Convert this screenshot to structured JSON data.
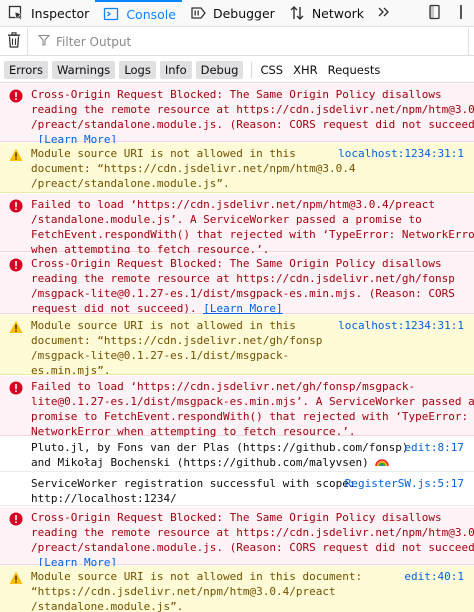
{
  "toolbar": {
    "tabs": [
      {
        "label": "Inspector"
      },
      {
        "label": "Console"
      },
      {
        "label": "Debugger"
      },
      {
        "label": "Network"
      }
    ]
  },
  "filter": {
    "placeholder": "Filter Output"
  },
  "levels": [
    "Errors",
    "Warnings",
    "Logs",
    "Info",
    "Debug"
  ],
  "types": [
    "CSS",
    "XHR",
    "Requests"
  ],
  "learn_more": "[Learn More]",
  "messages": [
    {
      "type": "error",
      "lines": [
        "Cross-Origin Request Blocked: The Same Origin Policy disallows",
        "reading the remote resource at https://cdn.jsdelivr.net/npm/htm@3.0.4",
        "/preact/standalone.module.js. (Reason: CORS request did not succeed)."
      ]
    },
    {
      "type": "warn",
      "lines": [
        "Module source URI is not allowed in this",
        "document: “https://cdn.jsdelivr.net/npm/htm@3.0.4",
        "/preact/standalone.module.js”."
      ],
      "location": "localhost:1234:31:1"
    },
    {
      "type": "error",
      "lines": [
        "Failed to load ‘https://cdn.jsdelivr.net/npm/htm@3.0.4/preact",
        "/standalone.module.js’. A ServiceWorker passed a promise to",
        "FetchEvent.respondWith() that rejected with ‘TypeError: NetworkError",
        "when attempting to fetch resource.’."
      ]
    },
    {
      "type": "error",
      "lines": [
        "Cross-Origin Request Blocked: The Same Origin Policy disallows",
        "reading the remote resource at https://cdn.jsdelivr.net/gh/fonsp",
        "/msgpack-lite@0.1.27-es.1/dist/msgpack-es.min.mjs. (Reason: CORS",
        "request did not succeed)."
      ]
    },
    {
      "type": "warn",
      "lines": [
        "Module source URI is not allowed in this",
        "document: “https://cdn.jsdelivr.net/gh/fonsp",
        "/msgpack-lite@0.1.27-es.1/dist/msgpack-",
        "es.min.mjs”."
      ],
      "location": "localhost:1234:31:1"
    },
    {
      "type": "error",
      "lines": [
        "Failed to load ‘https://cdn.jsdelivr.net/gh/fonsp/msgpack-",
        "lite@0.1.27-es.1/dist/msgpack-es.min.mjs’. A ServiceWorker passed a",
        "promise to FetchEvent.respondWith() that rejected with ‘TypeError:",
        "NetworkError when attempting to fetch resource.’."
      ]
    },
    {
      "type": "log",
      "lines": [
        "Pluto.jl, by Fons van der Plas (https://github.com/fonsp)",
        "and Mikołaj Bochenski (https://github.com/malyvsen)"
      ],
      "location": "edit:8:17"
    },
    {
      "type": "log",
      "lines": [
        "ServiceWorker registration successful with scope:",
        "http://localhost:1234/"
      ],
      "location": "RegisterSW.js:5:17"
    },
    {
      "type": "error",
      "lines": [
        "Cross-Origin Request Blocked: The Same Origin Policy disallows",
        "reading the remote resource at https://cdn.jsdelivr.net/npm/htm@3.0.4",
        "/preact/standalone.module.js. (Reason: CORS request did not succeed)."
      ]
    },
    {
      "type": "warn",
      "lines": [
        "Module source URI is not allowed in this document:",
        "“https://cdn.jsdelivr.net/npm/htm@3.0.4/preact",
        "/standalone.module.js”."
      ],
      "location": "edit:40:1"
    }
  ],
  "colors": {
    "error_bg": "#fdf2f5",
    "error_text": "#a4000f",
    "warn_bg": "#fffbd6",
    "warn_text": "#715100",
    "link": "#0060df",
    "accent": "#0a84ff"
  },
  "icons": [
    "inspector-icon",
    "console-icon",
    "debugger-icon",
    "network-icon",
    "toolbox-more-icon",
    "dock-icon",
    "trash-icon",
    "filter-icon",
    "error-icon",
    "warning-icon",
    "rainbow-icon"
  ]
}
